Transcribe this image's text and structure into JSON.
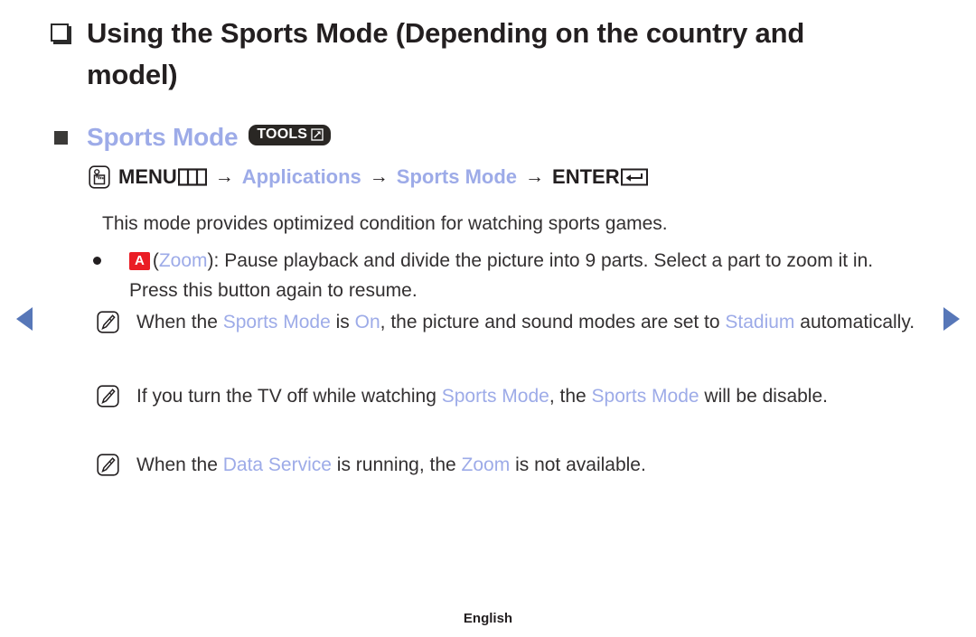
{
  "page": {
    "title": "Using the Sports Mode (Depending on the country and model)",
    "footer_label": "English"
  },
  "colors": {
    "highlight_blue": "#9dabe8",
    "key_red": "#ea1d25",
    "arrow_blue": "#5777b8",
    "text_dark": "#333031",
    "badge_dark": "#2a2724"
  },
  "section": {
    "heading": "Sports Mode",
    "tools_badge_label": "TOOLS",
    "tools_badge_icon": "box-arrow-up-right-icon"
  },
  "menu_path": {
    "press_icon": "hand-press-button-icon",
    "menu_label": "MENU",
    "menu_icon": "menu-columns-icon",
    "arrow": "→",
    "step_applications": "Applications",
    "step_sports_mode": "Sports Mode",
    "enter_label": "ENTER",
    "enter_icon": "enter-return-icon"
  },
  "description": "This mode provides optimized condition for watching sports games.",
  "bullet": {
    "key_label": "A",
    "key_icon": "red-a-key-icon",
    "text_open_paren": "(",
    "zoom_label": "Zoom",
    "text_rest": "): Pause playback and divide the picture into 9 parts. Select a part to zoom it in. Press this button again to resume."
  },
  "notes": [
    {
      "icon": "note-pencil-icon",
      "parts": [
        {
          "text": "When the ",
          "style": "normal"
        },
        {
          "text": "Sports Mode",
          "style": "highlight"
        },
        {
          "text": " is ",
          "style": "normal"
        },
        {
          "text": "On",
          "style": "highlight"
        },
        {
          "text": ", the picture and sound modes are set to ",
          "style": "normal"
        },
        {
          "text": "Stadium",
          "style": "highlight"
        },
        {
          "text": " automatically.",
          "style": "normal"
        }
      ],
      "plain": "When the Sports Mode is On, the picture and sound modes are set to Stadium automatically."
    },
    {
      "icon": "note-pencil-icon",
      "parts": [
        {
          "text": "If you turn the TV off while watching ",
          "style": "normal"
        },
        {
          "text": "Sports Mode",
          "style": "highlight"
        },
        {
          "text": ", the ",
          "style": "normal"
        },
        {
          "text": "Sports Mode",
          "style": "highlight"
        },
        {
          "text": " will be disable.",
          "style": "normal"
        }
      ],
      "plain": "If you turn the TV off while watching Sports Mode, the Sports Mode will be disable."
    },
    {
      "icon": "note-pencil-icon",
      "parts": [
        {
          "text": "When the ",
          "style": "normal"
        },
        {
          "text": "Data Service",
          "style": "highlight"
        },
        {
          "text": " is running, the ",
          "style": "normal"
        },
        {
          "text": "Zoom",
          "style": "highlight"
        },
        {
          "text": " is not available.",
          "style": "normal"
        }
      ],
      "plain": "When the Data Service is running, the Zoom is not available."
    }
  ],
  "navigation": {
    "prev_icon": "triangle-left-icon",
    "next_icon": "triangle-right-icon"
  }
}
